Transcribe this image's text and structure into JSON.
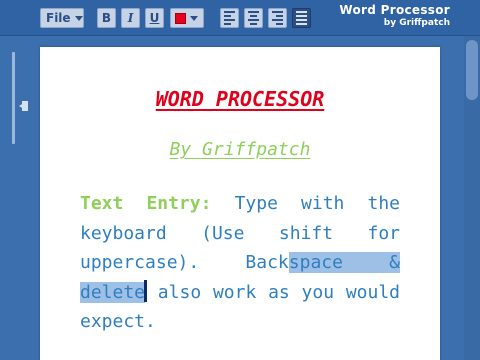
{
  "toolbar": {
    "file_label": "File",
    "bold_label": "B",
    "italic_label": "I",
    "underline_label": "U",
    "text_color": "#e8001c",
    "active_alignment": "justify"
  },
  "brand": {
    "title": "Word Processor",
    "subtitle": "by Griffpatch"
  },
  "document": {
    "title": "WORD PROCESSOR",
    "byline": "By Griffpatch",
    "body_lead": "Text Entry:",
    "body_part1": " Type with the keyboard (Use shift for uppercase). Back",
    "body_selected_1": "space & ",
    "body_selected_2": "delete",
    "body_part2": " also work as you would expect."
  },
  "colors": {
    "title": "#e0001b",
    "byline": "#8fcf5a",
    "body": "#2f7fc0",
    "selection": "#9ec0e6",
    "toolbar": "#2f63a4",
    "background": "#3b6fae"
  }
}
